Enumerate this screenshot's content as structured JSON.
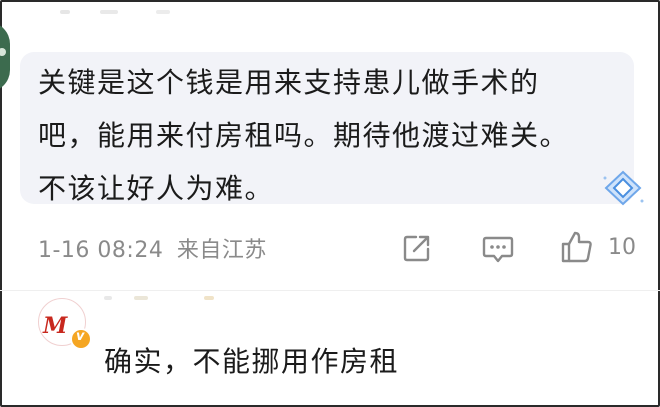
{
  "comment": {
    "text": "关键是这个钱是用来支持患儿做手术的\n吧，能用来付房租吗。期待他渡过难关。\n不该让好人为难。",
    "date": "1-16 08:24",
    "location": "来自江苏",
    "like_count": "10",
    "bubble_color": "#f2f3f8"
  },
  "actions": {
    "share_icon": "share-icon",
    "comment_icon": "comment-icon",
    "like_icon": "thumbs-up-icon"
  },
  "reply": {
    "text": "确实，不能挪用作房租",
    "verified_color": "#f5a623"
  }
}
